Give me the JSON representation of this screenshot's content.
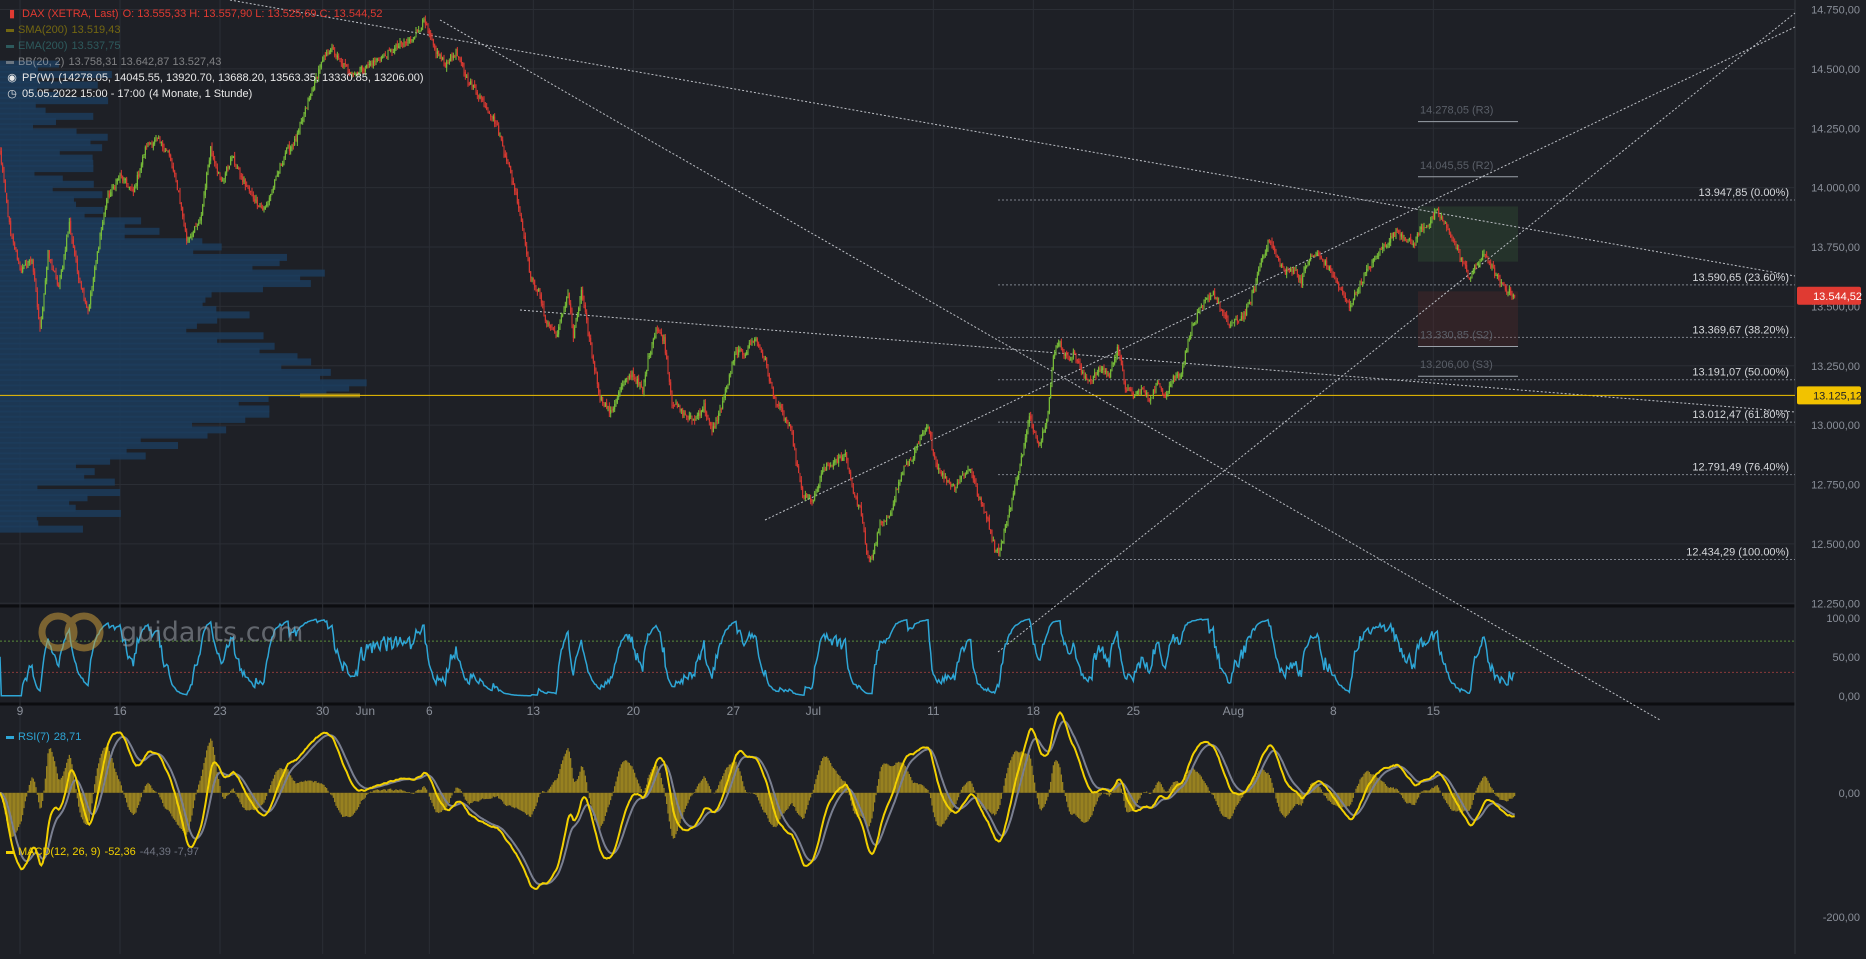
{
  "header": {
    "instrument": "DAX (XETRA, Last)",
    "ohlc": "O: 13.555,33  H: 13.557,90  L: 13.525,69  C: 13.544,52",
    "sma": {
      "label": "SMA(200)",
      "value": "13.519,43"
    },
    "ema": {
      "label": "EMA(200)",
      "value": "13.537,75"
    },
    "bb": {
      "label": "BB(20, 2)",
      "value": "13.758,31  13.642,87  13.527,43"
    },
    "pp": {
      "label": "PP(W)",
      "value": "(14278.05, 14045.55, 13920.70, 13688.20, 13563.35, 13330.85, 13206.00)"
    },
    "period": {
      "label": "05.05.2022 15:00 - 17:00",
      "value": "(4 Monate, 1 Stunde)"
    }
  },
  "watermark": "guidants.com",
  "colors": {
    "background": "#1e2026",
    "up": "#7bc33a",
    "down": "#e03a32",
    "level": "#f2c200",
    "rsi": "#2ea6d6",
    "macd": "#f2d000",
    "signal": "#7a7f90",
    "hist": "#a08820",
    "priceTag": "#e03a32"
  },
  "chart_data": [
    {
      "type": "candlestick",
      "name": "DAX 1h",
      "x_ticks": [
        "9",
        "16",
        "23",
        "30",
        "Jun",
        "6",
        "13",
        "20",
        "27",
        "Jul",
        "11",
        "18",
        "25",
        "Aug",
        "8",
        "15"
      ],
      "x_tick_index": [
        15,
        90,
        165,
        242,
        274,
        322,
        400,
        475,
        550,
        610,
        700,
        775,
        850,
        925,
        1000,
        1075
      ],
      "y_ticks": [
        "12.250,00",
        "12.500,00",
        "12.750,00",
        "13.000,00",
        "13.250,00",
        "13.500,00",
        "13.750,00",
        "14.000,00",
        "14.250,00",
        "14.500,00",
        "14.750,00"
      ],
      "y_tick_values": [
        12250,
        12500,
        12750,
        13000,
        13250,
        13500,
        13750,
        14000,
        14250,
        14500,
        14750
      ],
      "ylim": [
        12230,
        14790
      ],
      "last_price": {
        "value": 13544.52,
        "label": "13.544,52"
      },
      "level_line": {
        "value": 13125.12,
        "label": "13.125,12"
      },
      "close_anchors": [
        [
          0,
          14150
        ],
        [
          8,
          13800
        ],
        [
          16,
          13650
        ],
        [
          24,
          13700
        ],
        [
          30,
          13400
        ],
        [
          36,
          13720
        ],
        [
          44,
          13580
        ],
        [
          52,
          13850
        ],
        [
          58,
          13650
        ],
        [
          66,
          13480
        ],
        [
          74,
          13760
        ],
        [
          80,
          13950
        ],
        [
          90,
          14050
        ],
        [
          100,
          13980
        ],
        [
          110,
          14180
        ],
        [
          118,
          14200
        ],
        [
          126,
          14150
        ],
        [
          134,
          13980
        ],
        [
          140,
          13780
        ],
        [
          150,
          13850
        ],
        [
          158,
          14170
        ],
        [
          166,
          14020
        ],
        [
          174,
          14130
        ],
        [
          182,
          14030
        ],
        [
          190,
          13960
        ],
        [
          198,
          13900
        ],
        [
          206,
          14020
        ],
        [
          214,
          14150
        ],
        [
          222,
          14200
        ],
        [
          230,
          14340
        ],
        [
          240,
          14510
        ],
        [
          248,
          14590
        ],
        [
          256,
          14520
        ],
        [
          266,
          14480
        ],
        [
          278,
          14520
        ],
        [
          290,
          14560
        ],
        [
          300,
          14600
        ],
        [
          308,
          14620
        ],
        [
          318,
          14700
        ],
        [
          326,
          14580
        ],
        [
          334,
          14520
        ],
        [
          342,
          14570
        ],
        [
          350,
          14460
        ],
        [
          358,
          14400
        ],
        [
          366,
          14330
        ],
        [
          372,
          14270
        ],
        [
          380,
          14120
        ],
        [
          388,
          13950
        ],
        [
          394,
          13770
        ],
        [
          398,
          13620
        ],
        [
          404,
          13560
        ],
        [
          410,
          13430
        ],
        [
          418,
          13380
        ],
        [
          426,
          13560
        ],
        [
          430,
          13370
        ],
        [
          436,
          13560
        ],
        [
          444,
          13300
        ],
        [
          450,
          13120
        ],
        [
          458,
          13050
        ],
        [
          466,
          13160
        ],
        [
          474,
          13220
        ],
        [
          482,
          13140
        ],
        [
          486,
          13280
        ],
        [
          492,
          13410
        ],
        [
          498,
          13360
        ],
        [
          504,
          13100
        ],
        [
          512,
          13050
        ],
        [
          520,
          13020
        ],
        [
          528,
          13080
        ],
        [
          534,
          12970
        ],
        [
          540,
          13060
        ],
        [
          546,
          13180
        ],
        [
          552,
          13310
        ],
        [
          558,
          13300
        ],
        [
          566,
          13370
        ],
        [
          574,
          13270
        ],
        [
          580,
          13120
        ],
        [
          586,
          13060
        ],
        [
          590,
          13010
        ],
        [
          594,
          12960
        ],
        [
          598,
          12820
        ],
        [
          602,
          12700
        ],
        [
          610,
          12680
        ],
        [
          618,
          12820
        ],
        [
          626,
          12840
        ],
        [
          634,
          12880
        ],
        [
          640,
          12720
        ],
        [
          646,
          12630
        ],
        [
          650,
          12450
        ],
        [
          654,
          12440
        ],
        [
          660,
          12580
        ],
        [
          666,
          12600
        ],
        [
          672,
          12720
        ],
        [
          678,
          12820
        ],
        [
          684,
          12860
        ],
        [
          690,
          12940
        ],
        [
          696,
          12990
        ],
        [
          702,
          12840
        ],
        [
          708,
          12780
        ],
        [
          716,
          12740
        ],
        [
          722,
          12790
        ],
        [
          728,
          12820
        ],
        [
          734,
          12690
        ],
        [
          740,
          12620
        ],
        [
          746,
          12480
        ],
        [
          750,
          12470
        ],
        [
          756,
          12620
        ],
        [
          762,
          12760
        ],
        [
          768,
          12910
        ],
        [
          772,
          13030
        ],
        [
          776,
          12970
        ],
        [
          780,
          12920
        ],
        [
          786,
          13060
        ],
        [
          790,
          13280
        ],
        [
          794,
          13360
        ],
        [
          800,
          13280
        ],
        [
          806,
          13300
        ],
        [
          812,
          13210
        ],
        [
          818,
          13190
        ],
        [
          826,
          13240
        ],
        [
          832,
          13210
        ],
        [
          838,
          13330
        ],
        [
          844,
          13160
        ],
        [
          850,
          13120
        ],
        [
          856,
          13150
        ],
        [
          862,
          13110
        ],
        [
          868,
          13170
        ],
        [
          874,
          13130
        ],
        [
          880,
          13200
        ],
        [
          886,
          13220
        ],
        [
          892,
          13380
        ],
        [
          898,
          13460
        ],
        [
          904,
          13520
        ],
        [
          910,
          13560
        ],
        [
          916,
          13480
        ],
        [
          922,
          13420
        ],
        [
          928,
          13440
        ],
        [
          934,
          13470
        ],
        [
          940,
          13560
        ],
        [
          946,
          13700
        ],
        [
          952,
          13780
        ],
        [
          958,
          13700
        ],
        [
          964,
          13640
        ],
        [
          970,
          13660
        ],
        [
          976,
          13610
        ],
        [
          982,
          13700
        ],
        [
          988,
          13720
        ],
        [
          994,
          13680
        ],
        [
          1000,
          13630
        ],
        [
          1006,
          13560
        ],
        [
          1012,
          13500
        ],
        [
          1018,
          13570
        ],
        [
          1024,
          13640
        ],
        [
          1030,
          13690
        ],
        [
          1036,
          13740
        ],
        [
          1042,
          13780
        ],
        [
          1048,
          13820
        ],
        [
          1054,
          13790
        ],
        [
          1060,
          13760
        ],
        [
          1066,
          13830
        ],
        [
          1072,
          13850
        ],
        [
          1078,
          13900
        ],
        [
          1084,
          13840
        ],
        [
          1090,
          13780
        ],
        [
          1096,
          13700
        ],
        [
          1102,
          13620
        ],
        [
          1108,
          13680
        ],
        [
          1114,
          13720
        ],
        [
          1120,
          13650
        ],
        [
          1126,
          13590
        ],
        [
          1132,
          13560
        ],
        [
          1136,
          13544
        ]
      ]
    },
    {
      "type": "line",
      "name": "RSI(7)",
      "label": "RSI(7)",
      "value_label": "28,71",
      "y_ticks": [
        "100,00",
        "50,00",
        "0,00"
      ],
      "y_tick_values": [
        100,
        50,
        0
      ],
      "ylim": [
        -8,
        110
      ],
      "overbought": 70,
      "oversold": 30
    },
    {
      "type": "line",
      "name": "MACD(12, 26, 9)",
      "label": "MACD(12, 26, 9)",
      "values_label": "-52,36",
      "values_label_2": "-44,39  -7,97",
      "y_ticks": [
        "0,00",
        "-200,00"
      ],
      "y_tick_values": [
        0,
        -200
      ],
      "ylim": [
        -260,
        140
      ]
    },
    {
      "type": "fibonacci",
      "levels": [
        {
          "value": 13947.85,
          "label": "13.947,85 (0.00%)"
        },
        {
          "value": 13590.65,
          "label": "13.590,65 (23.60%)"
        },
        {
          "value": 13369.67,
          "label": "13.369,67 (38.20%)"
        },
        {
          "value": 13191.07,
          "label": "13.191,07 (50.00%)"
        },
        {
          "value": 13012.47,
          "label": "13.012,47 (61.80%)"
        },
        {
          "value": 12791.49,
          "label": "12.791,49 (76.40%)"
        },
        {
          "value": 12434.29,
          "label": "12.434,29 (100.00%)"
        }
      ]
    },
    {
      "type": "pivots",
      "levels": [
        {
          "value": 14278.05,
          "label": "14.278,05 (R3)"
        },
        {
          "value": 14045.55,
          "label": "14.045,55 (R2)"
        },
        {
          "value": 13330.85,
          "label": "13.330,85 (S2)"
        },
        {
          "value": 13206.0,
          "label": "13.206,00 (S3)"
        }
      ]
    }
  ]
}
